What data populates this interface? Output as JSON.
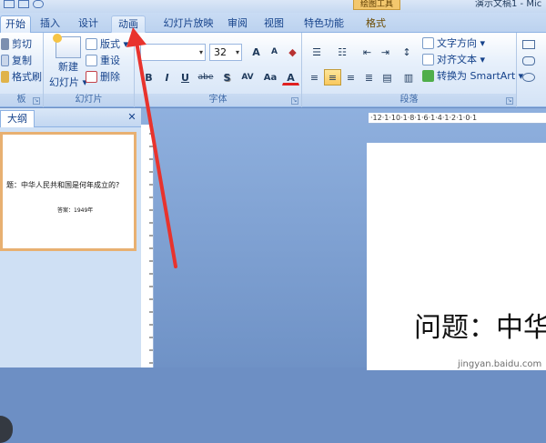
{
  "window": {
    "title": "演示文稿1 - Mic",
    "contextual_tools_label": "绘图工具"
  },
  "tabs": [
    {
      "label": "开始",
      "active": true
    },
    {
      "label": "插入"
    },
    {
      "label": "设计"
    },
    {
      "label": "动画"
    },
    {
      "label": "幻灯片放映"
    },
    {
      "label": "审阅"
    },
    {
      "label": "视图"
    },
    {
      "label": "特色功能"
    },
    {
      "label": "格式",
      "contextual": true
    }
  ],
  "ribbon": {
    "clipboard": {
      "cut": "剪切",
      "copy": "复制",
      "format_painter": "格式刷",
      "group_label": "板"
    },
    "slides": {
      "new_slide_line1": "新建",
      "new_slide_line2": "幻灯片 ▾",
      "layout": "版式 ▾",
      "reset": "重设",
      "delete": "删除",
      "group_label": "幻灯片"
    },
    "font": {
      "font_size": "32",
      "grow": "A",
      "shrink": "A",
      "bold": "B",
      "italic": "I",
      "underline": "U",
      "strike": "abe",
      "shadow": "S",
      "spacing": "AV",
      "case": "Aa",
      "color": "A",
      "group_label": "字体"
    },
    "paragraph": {
      "text_direction": "文字方向 ▾",
      "align_text": "对齐文本 ▾",
      "smartart": "转换为 SmartArt ▾",
      "group_label": "段落"
    }
  },
  "pane": {
    "tab_outline": "大纲",
    "close": "✕",
    "thumb_question": "题：中华人民共和国是何年成立的?",
    "thumb_answer": "答案：1949年"
  },
  "canvas": {
    "ruler_marks": "·12·1·10·1·8·1·6·1·4·1·2·1·0·1",
    "slide_text": "问题：中华",
    "watermark": "jingyan.baidu.com"
  },
  "colors": {
    "annotation_arrow": "#e8332d",
    "slide_thumb_border": "#e8b071"
  }
}
